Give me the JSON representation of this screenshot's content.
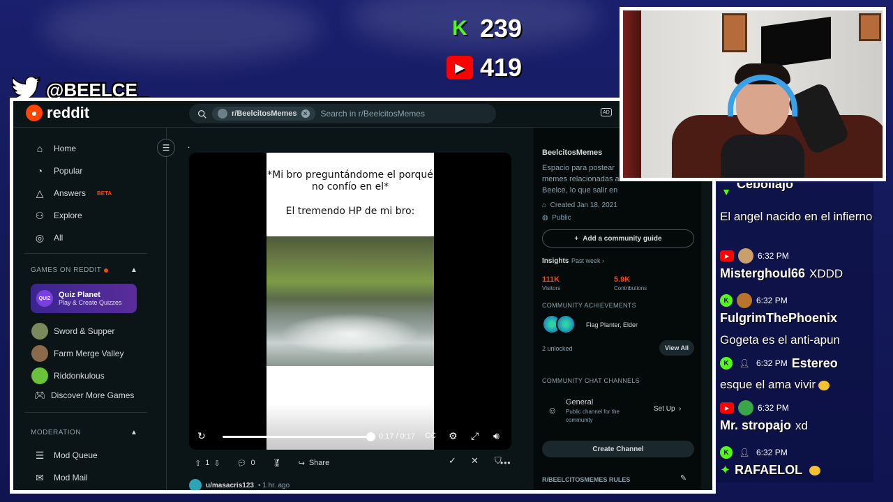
{
  "overlay": {
    "twitter_handle": "@BEELCE_",
    "kick_count": "239",
    "youtube_count": "419"
  },
  "reddit": {
    "logo_text": "reddit",
    "search": {
      "community_chip": "r/BeelcitosMemes",
      "placeholder": "Search in r/BeelcitosMemes"
    },
    "sidebar": {
      "nav": [
        {
          "label": "Home",
          "icon": "home-icon"
        },
        {
          "label": "Popular",
          "icon": "popular-icon"
        },
        {
          "label": "Answers",
          "icon": "answers-icon",
          "badge": "BETA"
        },
        {
          "label": "Explore",
          "icon": "explore-icon"
        },
        {
          "label": "All",
          "icon": "all-icon"
        }
      ],
      "games_heading": "GAMES ON REDDIT",
      "featured_game": {
        "title": "Quiz Planet",
        "subtitle": "Play & Create Quizzes",
        "logo": "QUIZ"
      },
      "games": [
        {
          "label": "Sword & Supper",
          "color": "#7a8a5a"
        },
        {
          "label": "Farm Merge Valley",
          "color": "#8a6a4a"
        },
        {
          "label": "Riddonkulous",
          "color": "#6ac23a"
        },
        {
          "label": "Discover More Games",
          "color": ""
        }
      ],
      "moderation_heading": "MODERATION",
      "moderation": [
        {
          "label": "Mod Queue"
        },
        {
          "label": "Mod Mail"
        }
      ]
    },
    "post": {
      "body": ".",
      "meme_line1": "*Mi bro preguntándome el porqué no confío en el*",
      "meme_line2": "El tremendo HP de mi bro:",
      "progress": 1.0,
      "time": "0:17 / 0:17",
      "votes": "1",
      "comments": "0",
      "share_label": "Share"
    },
    "next_post": {
      "user": "u/masacris123",
      "age": "• 1 hr. ago"
    },
    "community": {
      "name": "BeelcitosMemes",
      "description": "Espacio para postear memes relacionadas a Beelce, lo que salir en Stream!",
      "created": "Created Jan 18, 2021",
      "visibility": "Public",
      "guide_button": "Add a community guide",
      "insights_label": "Insights",
      "insights_period": "Past week",
      "visitors_value": "111K",
      "visitors_label": "Visitors",
      "contributions_value": "5.9K",
      "contributions_label": "Contributions",
      "achievements_heading": "COMMUNITY ACHIEVEMENTS",
      "achievements_text": "Flag Planter, Elder",
      "unlocked": "2 unlocked",
      "view_all": "View All",
      "chat_heading": "COMMUNITY CHAT CHANNELS",
      "channel_name": "General",
      "channel_desc": "Public channel for the community",
      "setup_label": "Set Up",
      "create_channel": "Create Channel",
      "rules_heading": "R/BEELCITOSMEMES RULES"
    }
  },
  "chat": {
    "top_partial_user": "Cebollajo",
    "messages": [
      {
        "platform": "",
        "time": "",
        "user": "",
        "text": "El angel nacido en el infierno"
      },
      {
        "platform": "youtube",
        "time": "6:32 PM",
        "user": "Misterghoul66",
        "text": "XDDD"
      },
      {
        "platform": "kick",
        "time": "6:32 PM",
        "user": "FulgrimThePhoenix",
        "text": "Gogeta es el anti-apun"
      },
      {
        "platform": "kick",
        "time": "6:32 PM",
        "user": "Estereo",
        "text": "esque el ama vivir"
      },
      {
        "platform": "youtube",
        "time": "6:32 PM",
        "user": "Mr. stropajo",
        "text": "xd"
      },
      {
        "platform": "kick",
        "time": "6:32 PM",
        "user": "RAFAELOL",
        "text": ""
      }
    ]
  },
  "colors": {
    "reddit_orange": "#ff4500",
    "kick_green": "#53fc18",
    "youtube_red": "#ff0000",
    "background_blue": "#1a1f6e"
  }
}
